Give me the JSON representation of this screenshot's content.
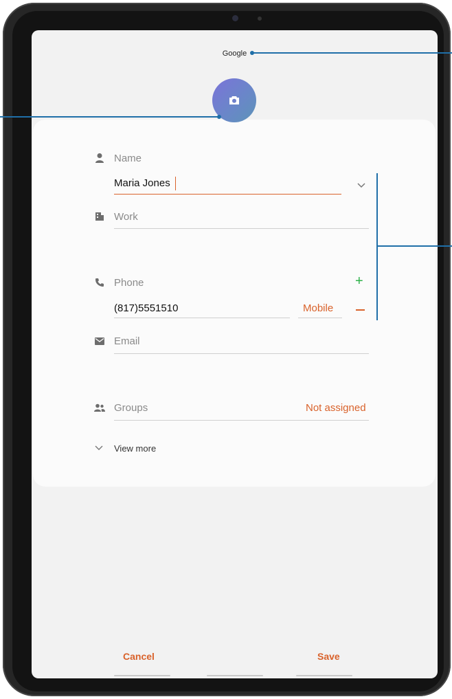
{
  "header": {
    "account": "Google"
  },
  "form": {
    "name": {
      "label": "Name",
      "value": "Maria Jones"
    },
    "work": {
      "label": "Work"
    },
    "phone": {
      "label": "Phone",
      "value": "(817)5551510",
      "type": "Mobile"
    },
    "email": {
      "label": "Email"
    },
    "groups": {
      "label": "Groups",
      "value": "Not assigned"
    },
    "view_more": "View more"
  },
  "footer": {
    "cancel": "Cancel",
    "save": "Save"
  },
  "colors": {
    "accent": "#d9622b",
    "add": "#2fb24a",
    "callout": "#1f6fa8"
  }
}
